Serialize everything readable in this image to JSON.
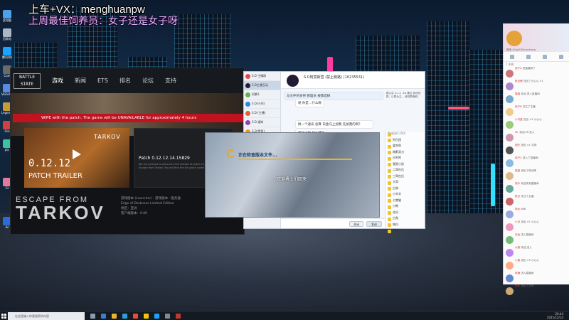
{
  "overlay": {
    "title": "上车+VX：menghuanpw",
    "subtitle": "上周最佳饲养员：女子还是女子呀"
  },
  "desktop_icons": [
    "此电脑",
    "回收站",
    "腾讯QQ",
    "Cam",
    "Voicemeeter",
    "Legends",
    "Gro",
    "ptc",
    "Gr",
    "Ac"
  ],
  "launcher": {
    "logo": "BATTLE STATE",
    "nav": [
      "游戏",
      "新闻",
      "ETS",
      "排名",
      "论坛",
      "支持"
    ],
    "alert": "WIPE with the patch. The game will be UNAVAILABLE for approximately 4 hours",
    "card1": {
      "brand": "TARKOV",
      "version": "0.12.12",
      "title": "PATCH TRAILER"
    },
    "card2": {
      "title": "Patch 0.12.12.14.15829",
      "text": "We are pleased to announce the release of patch 0.12.12.15829 for Escape from Tarkov. You will find the full patch notes at this link."
    },
    "game_logo_top": "ESCAPE FROM",
    "game_logo_main": "TARKOV",
    "edition_lines": [
      "游戏版本 (Launcher)  ·  游戏版本  ·  服务器",
      "Edge of Darkness Limited Edition",
      "地区：亚洲",
      "客户端版本：0.00"
    ]
  },
  "qq": {
    "group_title": "S.D阿莫斯营 (禁止跑路) (16235531)",
    "sidebar": [
      "S.D 主播群",
      "S.D主播互动",
      "阿紫3",
      "S.D(小刘)",
      "S.D (主播)",
      "S.D 通知",
      "S.D(黑哥)"
    ],
    "notice": "与文件的支持 管理员 按需选择",
    "messages": [
      "谢 你是…什么啊",
      "搞一个通讯 总算 白金马上加我 先加我的啊？",
      "每日上线 什么情况"
    ],
    "members_header": "群成员(1150)",
    "members": [
      "阿白团",
      "爱吃鱼",
      "暗影双刀",
      "乐呵呵",
      "我是小孩",
      "二哥在后",
      "三哥在后",
      "大哥",
      "白驹",
      "小羊羊",
      "七兽猫",
      "小熊",
      "凉风",
      "白兔",
      "独白",
      "卡拉",
      "二哥在后",
      "风吹",
      "夏日",
      "小明"
    ],
    "side_info": "群公告 2.1.1 .18 通过 游戏进群，以群为主。 修改群昵称。",
    "buttons": [
      "关闭",
      "发送"
    ]
  },
  "popup": {
    "status": "正在检查版本文件...",
    "overlay_text": "…欢迎勇士们回来"
  },
  "chat": {
    "streamer": "情深 (Gao2)Shuanhong",
    "stats": "7 888",
    "lines": [
      {
        "name": "用户A",
        "text": "进直播间了"
      },
      {
        "name": "粉丝牌",
        "text": "送出了小心心 ×1"
      },
      {
        "name": "喵喵",
        "text": "欢迎 进入直播间"
      },
      {
        "name": "用户B",
        "text": "关注了主播"
      },
      {
        "name": "小可爱",
        "text": "送出 ×3 小心心"
      },
      {
        "name": "Mr.",
        "text": "欢迎 Mr.进入"
      },
      {
        "name": "团长",
        "text": "送出 ×1 礼物"
      },
      {
        "name": "用户C",
        "text": "进入了直播间"
      },
      {
        "name": "猫猫",
        "text": "送出了荧光棒"
      },
      {
        "name": "观众",
        "text": "欢迎来到直播间"
      },
      {
        "name": "粉丝",
        "text": "关注了主播"
      },
      {
        "name": "阿木",
        "text": "666"
      },
      {
        "name": "小白",
        "text": "送出 ×1 小心心"
      },
      {
        "name": "白兔",
        "text": "进入直播间"
      },
      {
        "name": "大雄",
        "text": "欢迎 进入"
      },
      {
        "name": "小鹿",
        "text": "送出 ×5 小心心"
      },
      {
        "name": "阿楠",
        "text": "进入直播间"
      },
      {
        "name": "阿东",
        "text": "送出了礼物"
      }
    ]
  },
  "taskbar": {
    "search_placeholder": "在这里输入你要搜索的内容",
    "time": "20:44",
    "date": "2021/12/14"
  }
}
